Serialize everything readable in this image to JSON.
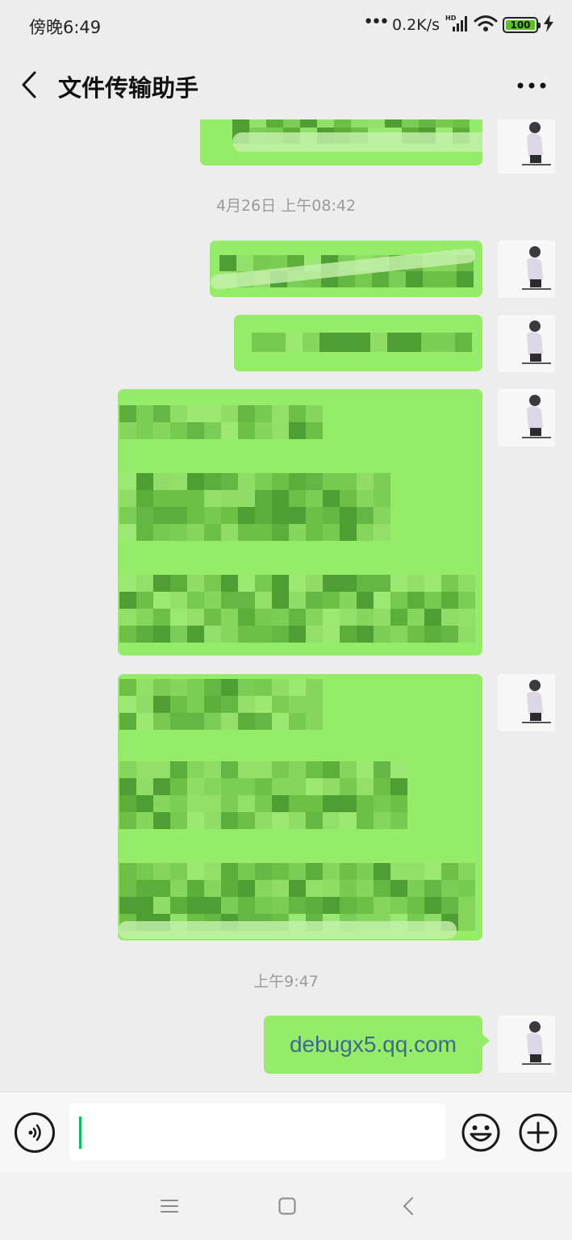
{
  "status_bar": {
    "time": "傍晚6:49",
    "net_speed": "0.2K/s",
    "battery": "100",
    "icons": [
      "more-dots-icon",
      "hd-signal-icon",
      "wifi-icon",
      "battery-icon",
      "charging-icon"
    ]
  },
  "header": {
    "title": "文件传输助手",
    "icons": [
      "back-arrow-icon",
      "more-icon"
    ]
  },
  "chat": {
    "timestamps": [
      "4月26日 上午08:42",
      "上午9:47"
    ],
    "last_message": "debugx5.qq.com"
  },
  "input_bar": {
    "value": "",
    "icons": [
      "voice-icon",
      "emoji-icon",
      "plus-icon"
    ]
  },
  "system_nav": {
    "icons": [
      "menu-icon",
      "home-icon",
      "back-icon"
    ]
  },
  "colors": {
    "background": "#ededed",
    "bubble": "#95ec69",
    "link_text": "#3e6b8a",
    "timestamp": "#9a9a9a"
  }
}
